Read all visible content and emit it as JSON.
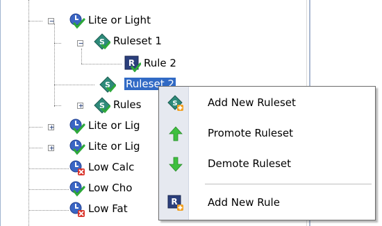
{
  "tree": {
    "nodes": [
      {
        "id": "lite-or-light",
        "label": "Lite or Light",
        "icon": "category-check-icon",
        "expander": "minus"
      },
      {
        "id": "ruleset-1",
        "label": "Ruleset 1",
        "icon": "ruleset-icon",
        "expander": "minus"
      },
      {
        "id": "rule-2",
        "label": "Rule 2",
        "icon": "rule-check-icon"
      },
      {
        "id": "ruleset-2",
        "label": "Ruleset 2",
        "icon": "ruleset-icon",
        "selected": true
      },
      {
        "id": "ruleset-3",
        "label": "Rules",
        "icon": "ruleset-icon",
        "expander": "plus"
      },
      {
        "id": "lite-or-light-2",
        "label": "Lite or Lig",
        "icon": "category-check-icon",
        "expander": "plus"
      },
      {
        "id": "lite-or-light-3",
        "label": "Lite or Lig",
        "icon": "category-check-icon",
        "expander": "plus"
      },
      {
        "id": "low-calorie",
        "label": "Low Calc",
        "icon": "category-error-icon"
      },
      {
        "id": "low-cholesterol",
        "label": "Low Cho",
        "icon": "category-check-icon"
      },
      {
        "id": "low-fat",
        "label": "Low Fat",
        "icon": "category-error-icon"
      }
    ]
  },
  "context_menu": {
    "items": [
      {
        "label": "Add New Ruleset",
        "icon": "add-ruleset-icon"
      },
      {
        "label": "Promote Ruleset",
        "icon": "up-arrow-icon"
      },
      {
        "label": "Demote Ruleset",
        "icon": "down-arrow-icon"
      },
      {
        "label": "Add New Rule",
        "icon": "add-rule-icon"
      }
    ]
  },
  "colors": {
    "selection": "#316ac5",
    "check_green": "#2ea83a",
    "error_red": "#d9342b",
    "ruleset_teal": "#2e8a7a",
    "rule_navy": "#2b3f7c",
    "category_blue": "#3b66c4",
    "arrow_green": "#3fbf3f"
  }
}
